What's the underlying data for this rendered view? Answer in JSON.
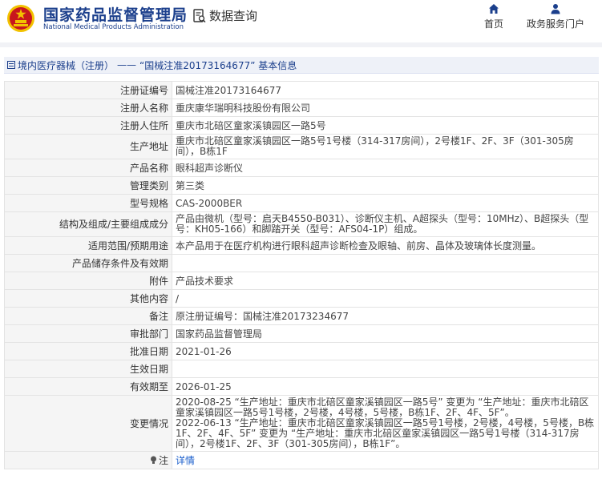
{
  "header": {
    "brand_cn": "国家药品监督管理局",
    "brand_en": "National Medical Products Administration",
    "query_label": "数据查询",
    "nav": {
      "home": "首页",
      "service": "政务服务门户"
    }
  },
  "breadcrumb": {
    "category": "境内医疗器械（注册）",
    "separator": "——",
    "title": "“国械注准20173164677” 基本信息"
  },
  "details": [
    {
      "label": "注册证编号",
      "value": "国械注准20173164677"
    },
    {
      "label": "注册人名称",
      "value": "重庆康华瑞明科技股份有限公司"
    },
    {
      "label": "注册人住所",
      "value": "重庆市北碚区童家溪镇园区一路5号"
    },
    {
      "label": "生产地址",
      "value": "重庆市北碚区童家溪镇园区一路5号1号楼（314-317房间），2号楼1F、2F、3F（301-305房间），B栋1F"
    },
    {
      "label": "产品名称",
      "value": "眼科超声诊断仪"
    },
    {
      "label": "管理类别",
      "value": "第三类"
    },
    {
      "label": "型号规格",
      "value": "CAS-2000BER"
    },
    {
      "label": "结构及组成/主要组成成分",
      "value": "产品由微机（型号：启天B4550-B031）、诊断仪主机、A超探头（型号：10MHz）、B超探头（型号：KH05-166）和脚踏开关（型号：AFS04-1P）组成。"
    },
    {
      "label": "适用范围/预期用途",
      "value": "本产品用于在医疗机构进行眼科超声诊断检查及眼轴、前房、晶体及玻璃体长度测量。"
    },
    {
      "label": "产品储存条件及有效期",
      "value": ""
    },
    {
      "label": "附件",
      "value": "产品技术要求"
    },
    {
      "label": "其他内容",
      "value": "/"
    },
    {
      "label": "备注",
      "value": "原注册证编号：国械注准20173234677"
    },
    {
      "label": "审批部门",
      "value": "国家药品监督管理局"
    },
    {
      "label": "批准日期",
      "value": "2021-01-26"
    },
    {
      "label": "生效日期",
      "value": ""
    },
    {
      "label": "有效期至",
      "value": "2026-01-25"
    }
  ],
  "changes": {
    "label": "变更情况",
    "entries": [
      "2020-08-25 “生产地址：重庆市北碚区童家溪镇园区一路5号” 变更为 “生产地址：重庆市北碚区童家溪镇园区一路5号1号楼，2号楼，4号楼，5号楼，B栋1F、2F、4F、5F”。",
      "2022-06-13 “生产地址：重庆市北碚区童家溪镇园区一路5号1号楼，2号楼，4号楼，5号楼，B栋1F、2F、4F、5F” 变更为 “生产地址：重庆市北碚区童家溪镇园区一路5号1号楼（314-317房间），2号楼1F、2F、3F（301-305房间），B栋1F”。"
    ]
  },
  "note": {
    "label": "注",
    "link": "详情"
  },
  "colors": {
    "brand_blue": "#1b3f8c",
    "link_blue": "#1b5fcc",
    "label_bg": "#f5f5f5",
    "emblem_red": "#c8161d",
    "emblem_gold": "#f2c200"
  }
}
